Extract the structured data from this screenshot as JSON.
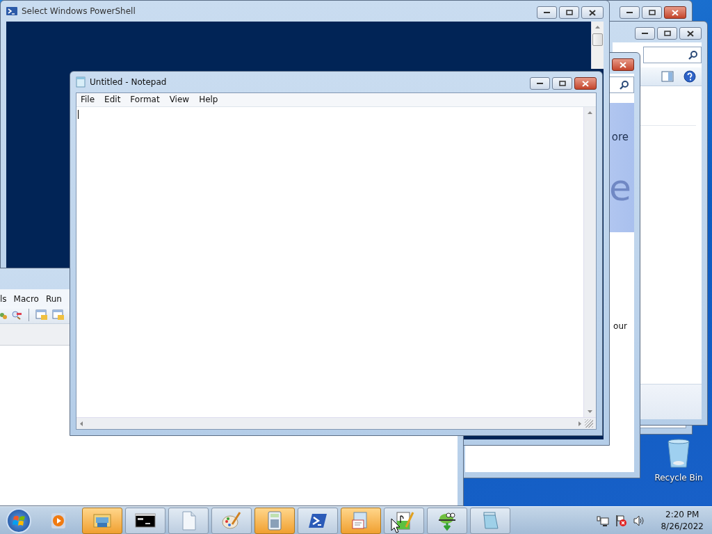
{
  "windows": [
    {
      "kind": "frame",
      "active": true
    },
    {
      "kind": "explorer",
      "active": false
    },
    {
      "kind": "help",
      "active": true,
      "texts": [
        "ore",
        "e",
        "our"
      ]
    },
    {
      "kind": "console",
      "title": "Select Windows PowerShell",
      "active": false
    },
    {
      "kind": "editor",
      "menu": [
        "ls",
        "Macro",
        "Run"
      ]
    },
    {
      "kind": "notepad",
      "title": "Untitled - Notepad",
      "active": true,
      "menu": [
        "File",
        "Edit",
        "Format",
        "View",
        "Help"
      ]
    }
  ],
  "desktop": {
    "icons": [
      {
        "label": "Recycle Bin"
      }
    ]
  },
  "taskbar": {
    "buttons": [
      {
        "kind": "media",
        "running": false,
        "flashing": false
      },
      {
        "kind": "explorer",
        "running": true,
        "flashing": true
      },
      {
        "kind": "cmd",
        "running": true,
        "flashing": false
      },
      {
        "kind": "document",
        "running": true,
        "flashing": false
      },
      {
        "kind": "paint",
        "running": true,
        "flashing": false
      },
      {
        "kind": "calculator",
        "running": true,
        "flashing": true
      },
      {
        "kind": "powershell",
        "running": true,
        "flashing": false
      },
      {
        "kind": "form",
        "running": true,
        "flashing": true
      },
      {
        "kind": "notepadpp",
        "running": true,
        "flashing": false
      },
      {
        "kind": "installer",
        "running": true,
        "flashing": false
      },
      {
        "kind": "notepad",
        "running": true,
        "flashing": false
      }
    ],
    "clock": {
      "time": "2:20 PM",
      "date": "8/26/2022"
    }
  }
}
